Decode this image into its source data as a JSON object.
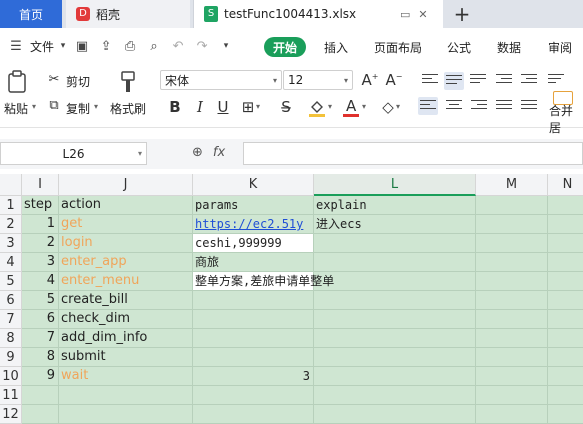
{
  "tabs": {
    "home": "首页",
    "docer": "稻壳",
    "file": "testFunc1004413.xlsx"
  },
  "menubar": {
    "file": "文件",
    "start": "开始",
    "items": [
      "插入",
      "页面布局",
      "公式",
      "数据",
      "审阅"
    ]
  },
  "ribbon": {
    "paste": "粘贴",
    "cut": "剪切",
    "copy": "复制",
    "format_painter": "格式刷",
    "font_name": "宋体",
    "font_size": "12",
    "merge": "合并居"
  },
  "formula_bar": {
    "cell_ref": "L26",
    "fx": "fx",
    "content": ""
  },
  "grid": {
    "columns": [
      "I",
      "J",
      "K",
      "L",
      "M",
      "N"
    ],
    "selected_column": "L",
    "row_numbers": [
      "1",
      "2",
      "3",
      "4",
      "5",
      "6",
      "7",
      "8",
      "9",
      "10",
      "11",
      "12"
    ],
    "header_row": {
      "step": "step",
      "action": "action",
      "params": "params",
      "explain": "explain"
    },
    "rows": [
      {
        "step": "1",
        "action": "get",
        "params": "https://ec2.51y",
        "explain": "进入ecs"
      },
      {
        "step": "2",
        "action": "login",
        "params": "ceshi,999999",
        "explain": ""
      },
      {
        "step": "3",
        "action": "enter_app",
        "params": "商旅",
        "explain": ""
      },
      {
        "step": "4",
        "action": "enter_menu",
        "params": "整单方案,差旅申请单整单",
        "explain": ""
      },
      {
        "step": "5",
        "action": "create_bill",
        "params": "",
        "explain": ""
      },
      {
        "step": "6",
        "action": "check_dim",
        "params": "",
        "explain": ""
      },
      {
        "step": "7",
        "action": "add_dim_info",
        "params": "",
        "explain": ""
      },
      {
        "step": "8",
        "action": "submit",
        "params": "",
        "explain": ""
      },
      {
        "step": "9",
        "action": "wait",
        "params": "3",
        "explain": ""
      }
    ]
  },
  "colors": {
    "accent_green": "#1a9e5a",
    "home_tab_blue": "#2f6bd8",
    "cell_fill": "#cfe6d2",
    "orange_text": "#f0a55a",
    "link_blue": "#1f4fd6"
  }
}
